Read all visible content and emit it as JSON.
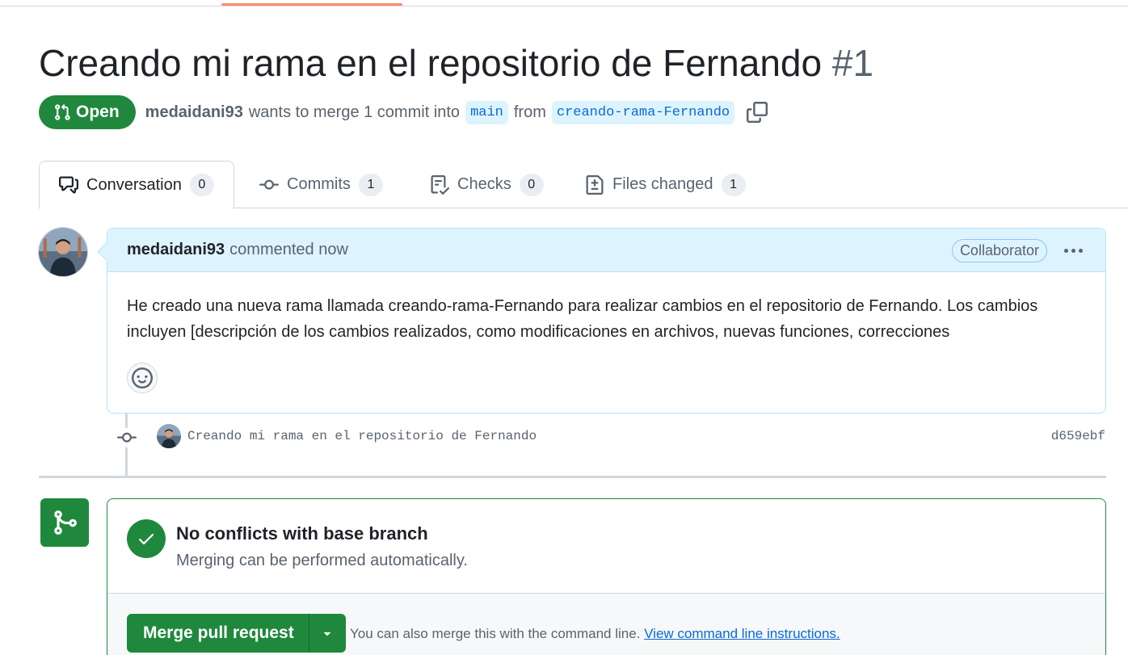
{
  "pull_request": {
    "title": "Creando mi rama en el repositorio de Fernando",
    "number": "#1",
    "state": "Open",
    "author": "medaidani93",
    "merge_text_1": "wants to merge 1 commit into",
    "base_branch": "main",
    "merge_text_2": "from",
    "head_branch": "creando-rama-Fernando"
  },
  "tabs": [
    {
      "label": "Conversation",
      "count": "0",
      "icon": "comment-discussion-icon",
      "selected": true
    },
    {
      "label": "Commits",
      "count": "1",
      "icon": "git-commit-icon"
    },
    {
      "label": "Checks",
      "count": "0",
      "icon": "checklist-icon"
    },
    {
      "label": "Files changed",
      "count": "1",
      "icon": "file-diff-icon"
    }
  ],
  "comment": {
    "author": "medaidani93",
    "action": "commented now",
    "role": "Collaborator",
    "body": "He creado una nueva rama llamada creando-rama-Fernando para realizar cambios en el repositorio de Fernando. Los cambios incluyen [descripción de los cambios realizados, como modificaciones en archivos, nuevas funciones, correcciones"
  },
  "commit": {
    "message": "Creando mi rama en el repositorio de Fernando",
    "sha": "d659ebf"
  },
  "merge": {
    "status_title": "No conflicts with base branch",
    "status_subtitle": "Merging can be performed automatically.",
    "button_label": "Merge pull request",
    "hint_text": "You can also merge this with the command line.",
    "hint_link": "View command line instructions."
  },
  "colors": {
    "success": "#1f883d",
    "accent": "#0969da",
    "comment_header": "#ddf4ff",
    "tab_underline": "#fd8c73"
  }
}
